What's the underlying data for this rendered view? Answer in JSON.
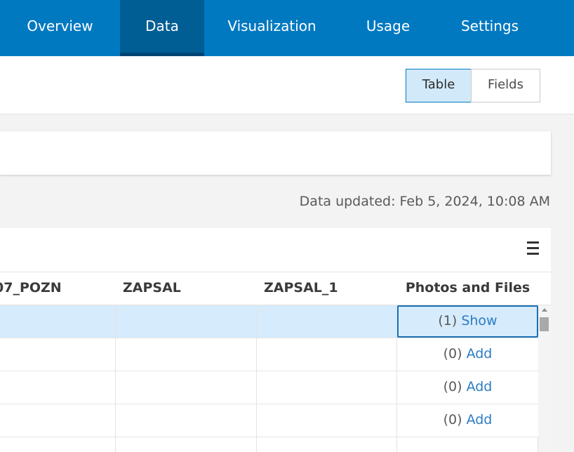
{
  "nav": {
    "tabs": [
      {
        "label": "Overview",
        "active": false
      },
      {
        "label": "Data",
        "active": true
      },
      {
        "label": "Visualization",
        "active": false
      },
      {
        "label": "Usage",
        "active": false
      },
      {
        "label": "Settings",
        "active": false
      }
    ]
  },
  "view_toggle": {
    "table_label": "Table",
    "fields_label": "Fields",
    "selected": "Table"
  },
  "status": {
    "updated_text": "Data updated: Feb 5, 2024, 10:08 AM"
  },
  "table": {
    "columns": [
      "07_POZN",
      "ZAPSAL",
      "ZAPSAL_1",
      "Photos and Files"
    ],
    "rows": [
      {
        "pozn": "",
        "zapsal": "",
        "zapsal_1": "",
        "attach_count": "(1)",
        "attach_action": "Show",
        "selected": true
      },
      {
        "pozn": "",
        "zapsal": "",
        "zapsal_1": "",
        "attach_count": "(0)",
        "attach_action": "Add",
        "selected": false
      },
      {
        "pozn": "",
        "zapsal": "",
        "zapsal_1": "",
        "attach_count": "(0)",
        "attach_action": "Add",
        "selected": false
      },
      {
        "pozn": "",
        "zapsal": "",
        "zapsal_1": "",
        "attach_count": "(0)",
        "attach_action": "Add",
        "selected": false
      },
      {
        "pozn": "",
        "zapsal": "",
        "zapsal_1": "",
        "attach_count": "",
        "attach_action": "",
        "selected": false
      }
    ]
  },
  "colors": {
    "nav_bg": "#0079c1",
    "nav_active": "#005e95",
    "link": "#2b7cc3",
    "selection": "#d6ebfb"
  }
}
